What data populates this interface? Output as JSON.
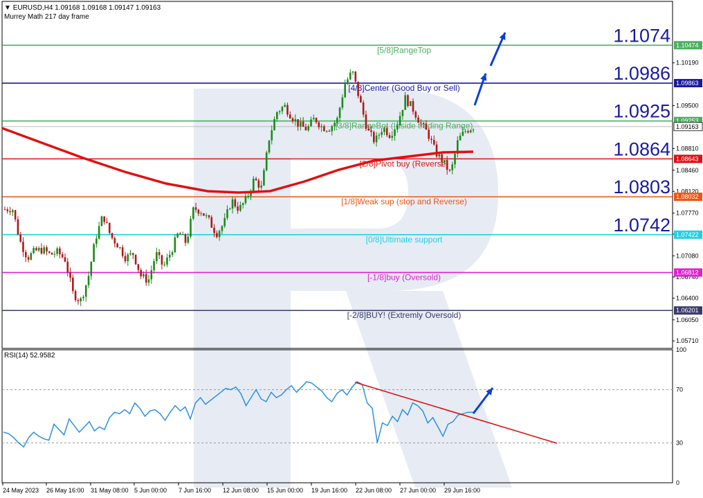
{
  "header": {
    "symbol_line": "EURUSD,H4  1.09168 1.09168 1.09147 1.09163",
    "indicator_line": "Murrey Math 217 day frame",
    "rsi_line": "RSI(14) 52.9582"
  },
  "colors": {
    "bull": "#1a8a1a",
    "bear": "#b01818",
    "ma": "#e01010",
    "rsi": "#2f8fe0",
    "trend": "#dd1111",
    "arrow": "#0a3fd8",
    "watermark": "#e6ebf4"
  },
  "chart_data": [
    {
      "type": "candlestick",
      "title": "EURUSD,H4",
      "ylim": [
        1.0559,
        1.1118
      ],
      "y_ticks": [
        "1.10190",
        "1.09500",
        "1.08810",
        "1.08460",
        "1.08120",
        "1.07770",
        "1.07430",
        "1.07080",
        "1.06740",
        "1.06400",
        "1.06050",
        "1.05710"
      ],
      "x_ticks": [
        "24 May 2023",
        "26 May 16:00",
        "31 May 08:00",
        "5 Jun 00:00",
        "7 Jun 16:00",
        "12 Jun 08:00",
        "15 Jun 00:00",
        "19 Jun 16:00",
        "22 Jun 08:00",
        "27 Jun 00:00",
        "29 Jun 16:00"
      ],
      "current_price": "1.09163",
      "moving_average": "217-period, red line from 1.0860 rising to 1.0863 after a dip near 1.0801",
      "murrey_levels": [
        {
          "label": "[5/8]RangeTop",
          "value": 1.10474,
          "tag": "1.10474",
          "big": "1.1074",
          "color": "#4caf60"
        },
        {
          "label": "[4/8]Center (Good Buy or Sell)",
          "value": 1.09863,
          "tag": "1.09863",
          "big": "1.0986",
          "color": "#1a1aa0"
        },
        {
          "label": "[3/8]RangeBot (Inside trading Range)",
          "value": 1.09253,
          "tag": "1.09253",
          "big": "1.0925",
          "color": "#4caf60"
        },
        {
          "label": "[2/8]Pivot buy (Reverse)",
          "value": 1.08643,
          "tag": "1.08643",
          "big": "1.0864",
          "color": "#dd1111"
        },
        {
          "label": "[1/8]Weak sup (stop and Reverse)",
          "value": 1.08032,
          "tag": "1.08032",
          "big": "1.0803",
          "color": "#ee5511"
        },
        {
          "label": "[0/8]Ultimate support",
          "value": 1.07422,
          "tag": "1.07422",
          "big": "1.0742",
          "color": "#22d0e0"
        },
        {
          "label": "[-1/8]buy (Oversold)",
          "value": 1.06812,
          "tag": "1.06812",
          "big": "",
          "color": "#e020d0"
        },
        {
          "label": "[-2/8]BUY! (Extremly Oversold)",
          "value": 1.06201,
          "tag": "1.06201",
          "big": "",
          "color": "#3a3a6a"
        }
      ],
      "candle_path": [
        1.0783,
        1.0785,
        1.0732,
        1.0705,
        1.0716,
        1.0718,
        1.071,
        1.0714,
        1.0702,
        1.0648,
        1.0635,
        1.0671,
        1.0736,
        1.0774,
        1.074,
        1.0725,
        1.0705,
        1.0712,
        1.0676,
        1.0668,
        1.0712,
        1.069,
        1.0715,
        1.0746,
        1.0729,
        1.0785,
        1.078,
        1.0765,
        1.0744,
        1.076,
        1.0798,
        1.0783,
        1.08,
        1.0832,
        1.0817,
        1.0899,
        1.094,
        1.095,
        1.0932,
        1.0918,
        1.0912,
        1.093,
        1.0915,
        1.0914,
        1.0928,
        1.0985,
        1.1005,
        1.0957,
        1.091,
        1.0892,
        1.0915,
        1.0903,
        1.0923,
        1.0962,
        1.0945,
        1.0922,
        1.0905,
        1.0875,
        1.086,
        1.084,
        1.0895,
        1.091,
        1.0916
      ]
    },
    {
      "type": "line",
      "title": "RSI(14) 52.9582",
      "ylim": [
        0,
        100
      ],
      "y_ticks": [
        "100",
        "70",
        "30",
        "0"
      ],
      "levels": [
        70,
        30
      ],
      "values": [
        38,
        37,
        34,
        30,
        27,
        34,
        38,
        35,
        33,
        32,
        44,
        40,
        36,
        48,
        43,
        38,
        42,
        46,
        39,
        42,
        40,
        49,
        53,
        52,
        55,
        52,
        60,
        56,
        50,
        54,
        55,
        52,
        47,
        53,
        58,
        54,
        57,
        48,
        60,
        64,
        59,
        62,
        65,
        68,
        71,
        70,
        72,
        67,
        58,
        64,
        70,
        63,
        61,
        68,
        64,
        66,
        70,
        73,
        68,
        72,
        76,
        75,
        72,
        69,
        64,
        61,
        67,
        70,
        66,
        72,
        76,
        74,
        60,
        56,
        30,
        45,
        43,
        50,
        46,
        55,
        51,
        60,
        58,
        54,
        45,
        49,
        42,
        35,
        44,
        46,
        51,
        52,
        53,
        53
      ],
      "trendline": [
        [
          71,
          76
        ],
        [
          106,
          28
        ]
      ]
    }
  ]
}
